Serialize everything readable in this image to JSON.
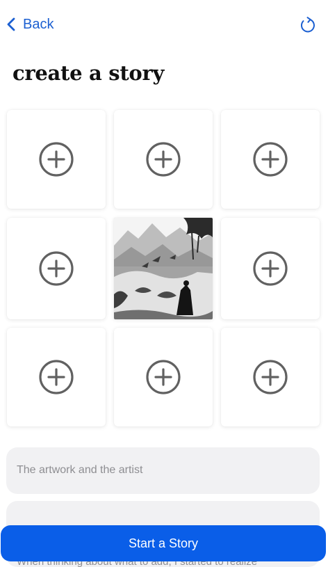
{
  "nav": {
    "back_label": "Back",
    "back_icon": "chevron-left-icon",
    "refresh_icon": "refresh-icon",
    "accent_color": "#1b5fd1"
  },
  "page_title": "create a story",
  "grid": {
    "rows": 3,
    "columns": 3,
    "add_icon": "plus-circle-icon",
    "filled_slot": 5,
    "filled_image": "ink-wash landscape illustration with mountains, birds and a seated figure"
  },
  "fields": {
    "title_placeholder": "The artwork and the artist",
    "body_text": "When thinking about what to add, I started to realize"
  },
  "start_button": {
    "label": "Start a Story",
    "color": "#0a5ee8"
  }
}
